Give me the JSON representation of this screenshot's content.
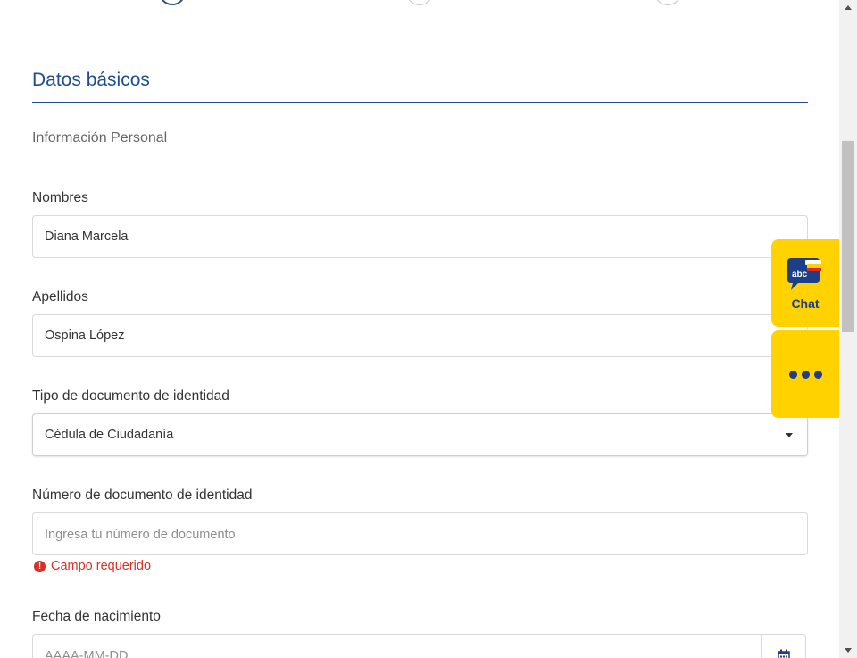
{
  "section": {
    "title": "Datos básicos",
    "subtitle": "Información Personal"
  },
  "form": {
    "nombres": {
      "label": "Nombres",
      "value": "Diana Marcela"
    },
    "apellidos": {
      "label": "Apellidos",
      "value": "Ospina López"
    },
    "tipo_documento": {
      "label": "Tipo de documento de identidad",
      "selected": "Cédula de Ciudadanía"
    },
    "numero_documento": {
      "label": "Número de documento de identidad",
      "placeholder": "Ingresa tu número de documento",
      "error": "Campo requerido"
    },
    "fecha_nacimiento": {
      "label": "Fecha de nacimiento",
      "placeholder": "AAAA-MM-DD"
    }
  },
  "widgets": {
    "chat_label": "Chat",
    "chat_logo_text": "abc"
  },
  "colors": {
    "accent": "#1f4e8c",
    "widget_bg": "#ffd200",
    "error": "#d93025"
  },
  "icons": [
    "calendar-icon",
    "error-icon",
    "chat-logo-icon",
    "more-dots-icon",
    "caret-down-icon"
  ]
}
